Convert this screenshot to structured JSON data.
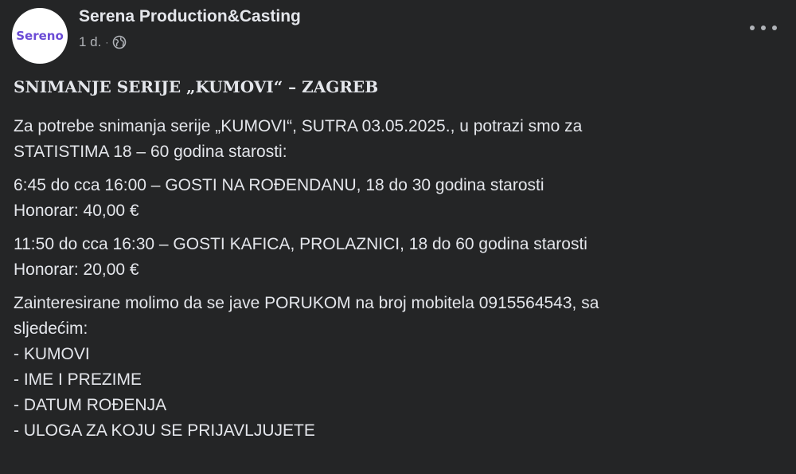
{
  "post": {
    "page_name": "Serena Production&Casting",
    "avatar_text": "Sereno",
    "timestamp": "1 d.",
    "separator": "·",
    "audience_icon": "globe-icon",
    "more_icon": "more-options-icon",
    "title": "SNIMANJE SERIJE „KUMOVI“ – ZAGREB",
    "paragraphs": [
      [
        "Za potrebe snimanja serije „KUMOVI“, SUTRA 03.05.2025., u potrazi smo za",
        "STATISTIMA 18 – 60 godina starosti:"
      ],
      [
        "6:45 do cca 16:00 – GOSTI NA ROĐENDANU, 18 do 30 godina starosti",
        "Honorar: 40,00 €"
      ],
      [
        "11:50 do cca 16:30 – GOSTI KAFICA, PROLAZNICI, 18 do 60 godina starosti",
        "Honorar: 20,00 €"
      ],
      [
        "Zainteresirane molimo da se jave PORUKOM na broj mobitela 0915564543, sa",
        "sljedećim:",
        "- KUMOVI",
        "- IME I PREZIME",
        "- DATUM ROĐENJA",
        "- ULOGA ZA KOJU SE PRIJAVLJUJETE"
      ]
    ]
  },
  "colors": {
    "background": "#242526",
    "text_primary": "#e4e6eb",
    "text_secondary": "#b0b3b8",
    "avatar_brand": "#6b4bd6"
  }
}
